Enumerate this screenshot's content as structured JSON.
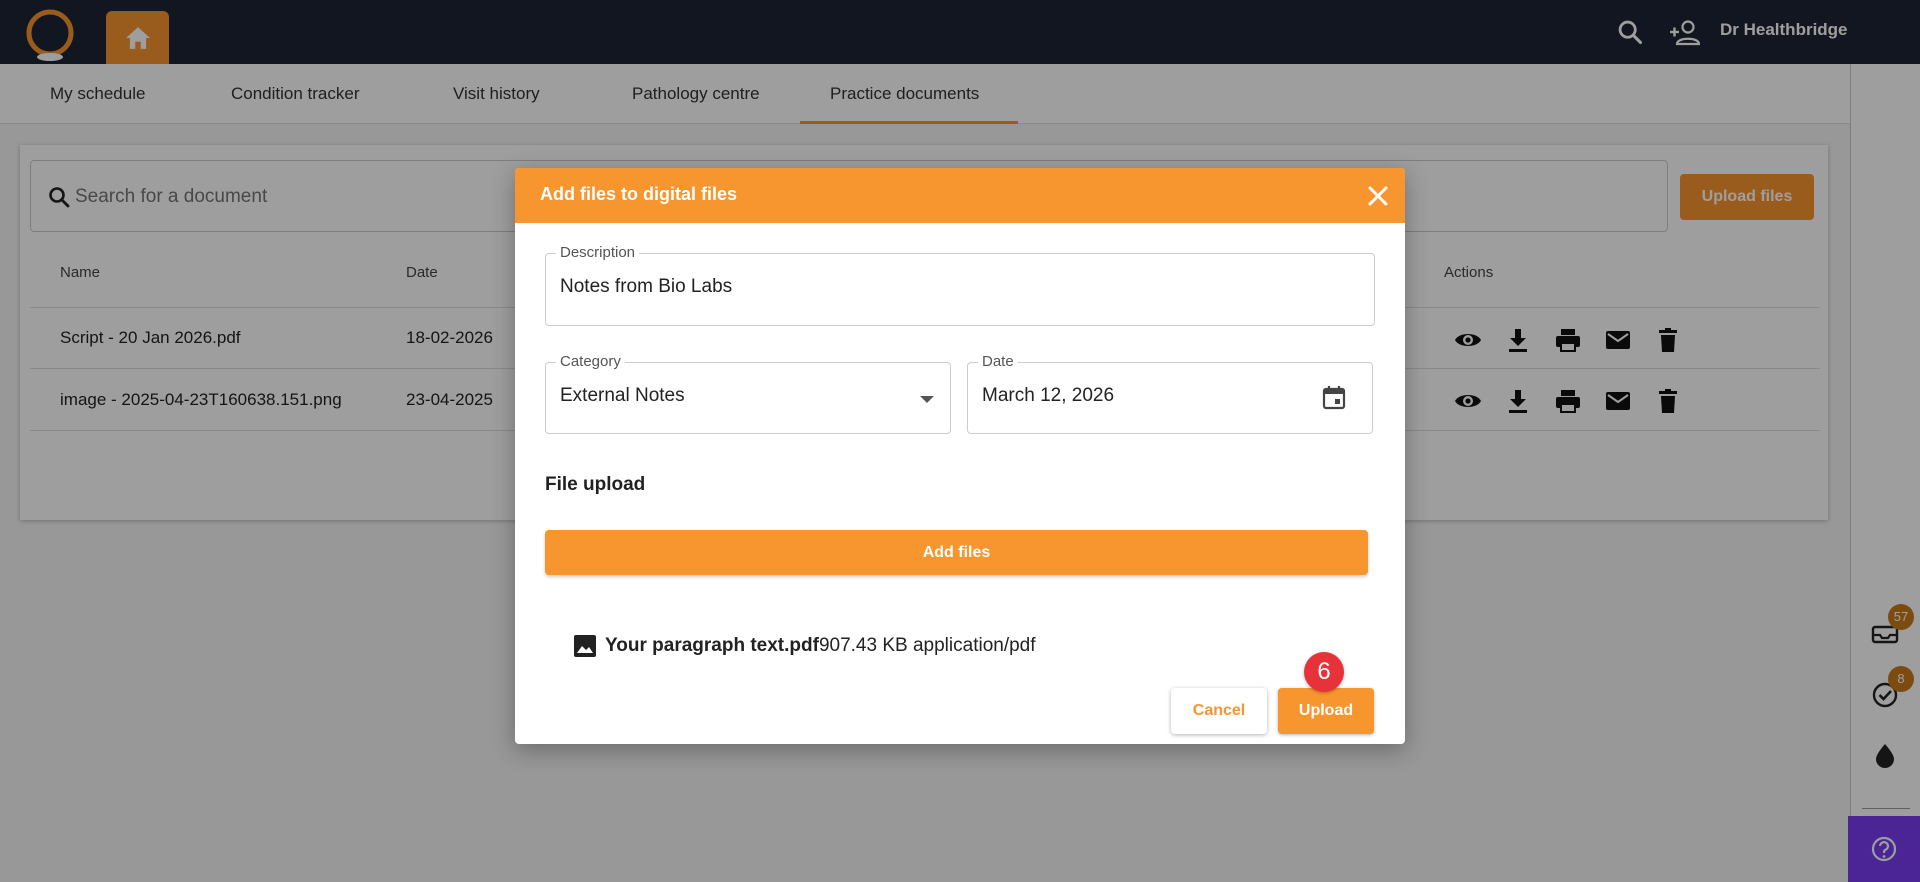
{
  "header": {
    "user_name": "Dr Healthbridge",
    "colors": {
      "bar": "#1c2434",
      "accent": "#f7952f"
    },
    "icons": [
      "logo-icon",
      "home-icon",
      "search-icon",
      "add-user-icon"
    ]
  },
  "tabs": [
    {
      "label": "My schedule"
    },
    {
      "label": "Condition tracker"
    },
    {
      "label": "Visit history"
    },
    {
      "label": "Pathology centre"
    },
    {
      "label": "Practice documents",
      "active": true
    }
  ],
  "documents": {
    "search_placeholder": "Search for a document",
    "upload_files_label": "Upload files",
    "columns": {
      "name": "Name",
      "date": "Date",
      "actions": "Actions"
    },
    "rows": [
      {
        "name": "Script - 20 Jan 2026.pdf",
        "date": "18-02-2026"
      },
      {
        "name": "image - 2025-04-23T160638.151.png",
        "date": "23-04-2025"
      }
    ],
    "action_icons": [
      "view-icon",
      "download-icon",
      "print-icon",
      "email-icon",
      "delete-icon"
    ]
  },
  "sidebar": {
    "items": [
      {
        "icon": "inbox-icon",
        "badge": "57"
      },
      {
        "icon": "check-circle-icon",
        "badge": "8"
      },
      {
        "icon": "drop-icon"
      }
    ],
    "help_icon": "help-icon"
  },
  "modal": {
    "title": "Add files to digital files",
    "description_label": "Description",
    "description_value": "Notes from Bio Labs",
    "category_label": "Category",
    "category_value": "External Notes",
    "date_label": "Date",
    "date_value": "March 12, 2026",
    "file_upload_title": "File upload",
    "add_files_label": "Add files",
    "file": {
      "name": "Your paragraph text.pdf",
      "size": "907.43 KB",
      "type": "application/pdf"
    },
    "cancel_label": "Cancel",
    "upload_label": "Upload"
  },
  "step_marker": "6"
}
